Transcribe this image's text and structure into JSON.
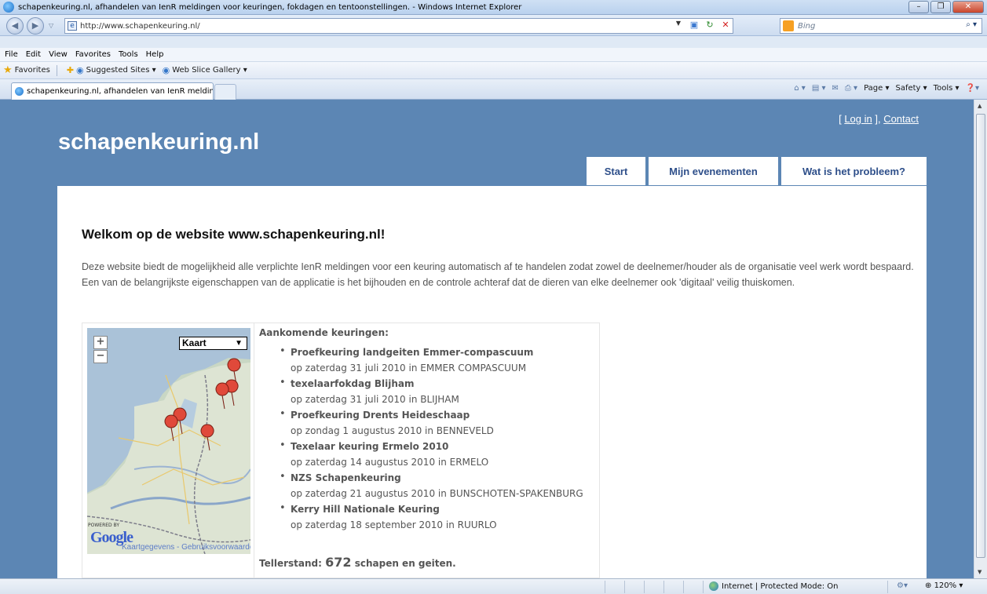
{
  "browser": {
    "window_title": "schapenkeuring.nl, afhandelen van IenR meldingen voor keuringen, fokdagen en tentoonstellingen. - Windows Internet Explorer",
    "address": "http://www.schapenkeuring.nl/",
    "search_placeholder": "Bing",
    "menu": [
      "File",
      "Edit",
      "View",
      "Favorites",
      "Tools",
      "Help"
    ],
    "favorites_label": "Favorites",
    "favorites_links": [
      "Suggested Sites ▾",
      "Web Slice Gallery ▾"
    ],
    "tab_title": "schapenkeuring.nl, afhandelen van IenR melding...",
    "commands": [
      "Page ▾",
      "Safety ▾",
      "Tools ▾"
    ],
    "status_zone": "Internet | Protected Mode: On",
    "zoom": "120%"
  },
  "site": {
    "logo": "schapenkeuring.nl",
    "login_prefix": "[ ",
    "login": "Log in",
    "login_suffix": " ], ",
    "contact": "Contact",
    "nav": [
      "Start",
      "Mijn evenementen",
      "Wat is het probleem?"
    ]
  },
  "main": {
    "heading": "Welkom op de website www.schapenkeuring.nl!",
    "intro_1": "Deze website biedt de mogelijkheid alle verplichte IenR meldingen voor een keuring automatisch af te handelen zodat zowel de deelnemer/houder als de organisatie veel werk wordt bespaard.",
    "intro_2": "Een van de belangrijkste eigenschappen van de applicatie is het bijhouden en de controle achteraf dat de dieren van elke deelnemer ook 'digitaal' veilig thuiskomen.",
    "upcoming_heading": "Aankomende keuringen:",
    "events": [
      {
        "name": "Proefkeuring landgeiten Emmer-compascuum",
        "date": "op zaterdag 31 juli 2010 in EMMER COMPASCUUM"
      },
      {
        "name": "texelaarfokdag Blijham",
        "date": "op zaterdag 31 juli 2010 in BLIJHAM"
      },
      {
        "name": "Proefkeuring Drents Heideschaap",
        "date": "op zondag 1 augustus 2010 in BENNEVELD"
      },
      {
        "name": "Texelaar keuring Ermelo 2010",
        "date": "op zaterdag 14 augustus 2010 in ERMELO"
      },
      {
        "name": "NZS Schapenkeuring",
        "date": "op zaterdag 21 augustus 2010 in BUNSCHOTEN-SPAKENBURG"
      },
      {
        "name": "Kerry Hill Nationale Keuring",
        "date": "op zaterdag 18 september 2010 in RUURLO"
      }
    ],
    "counter_label": "Tellerstand:",
    "counter_value": "672",
    "counter_suffix": "schapen en geiten."
  },
  "map": {
    "type_select": "Kaart",
    "zoom_in": "+",
    "zoom_out": "−",
    "powered_by": "POWERED BY",
    "google": "Google",
    "terms": "Kaartgegevens - Gebruiksvoorwaarden",
    "marker_color": "#e0493a"
  }
}
